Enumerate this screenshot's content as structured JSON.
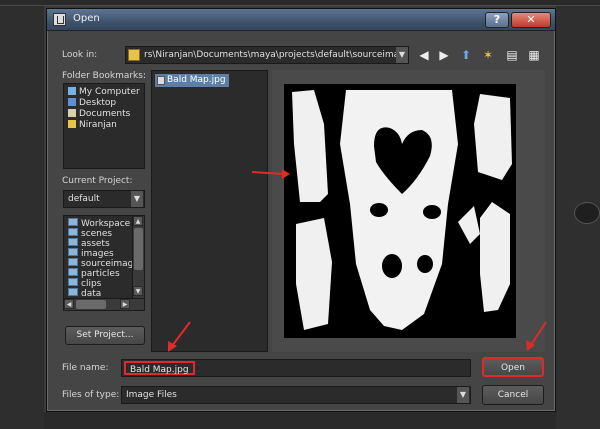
{
  "dialog": {
    "title": "Open",
    "help_glyph": "?",
    "close_glyph": "✕"
  },
  "look_in": {
    "label": "Look in:",
    "path": "rs\\Niranjan\\Documents\\maya\\projects\\default\\sourceimages",
    "toolbar": [
      {
        "name": "back-arrow-icon",
        "glyph": "◀"
      },
      {
        "name": "forward-arrow-icon",
        "glyph": "▶"
      },
      {
        "name": "up-arrow-icon",
        "glyph": "⬆"
      },
      {
        "name": "new-folder-icon",
        "glyph": "✶"
      },
      {
        "name": "list-view-icon",
        "glyph": "▤"
      },
      {
        "name": "detail-view-icon",
        "glyph": "▦"
      }
    ]
  },
  "bookmarks": {
    "label": "Folder Bookmarks:",
    "items": [
      {
        "label": "My Computer",
        "icon": "computer-icon",
        "color": "#7ab0e0"
      },
      {
        "label": "Desktop",
        "icon": "desktop-icon",
        "color": "#5c8fd6"
      },
      {
        "label": "Documents",
        "icon": "documents-icon",
        "color": "#d9d2a8"
      },
      {
        "label": "Niranjan",
        "icon": "user-folder-icon",
        "color": "#e8c34a"
      }
    ]
  },
  "project": {
    "label": "Current Project:",
    "value": "default",
    "folders": [
      "Workspace F",
      "scenes",
      "assets",
      "images",
      "sourceimage",
      "particles",
      "clips",
      "data"
    ],
    "set_button": "Set Project..."
  },
  "files": {
    "items": [
      {
        "name": "Bald Map.jpg",
        "selected": true
      }
    ]
  },
  "file_name": {
    "label": "File name:",
    "value": "Bald Map.jpg"
  },
  "file_type": {
    "label": "Files of type:",
    "value": "Image Files"
  },
  "buttons": {
    "open": "Open",
    "cancel": "Cancel"
  },
  "colors": {
    "accent_highlight": "#e02a2a",
    "selection": "#5d7fa6"
  }
}
